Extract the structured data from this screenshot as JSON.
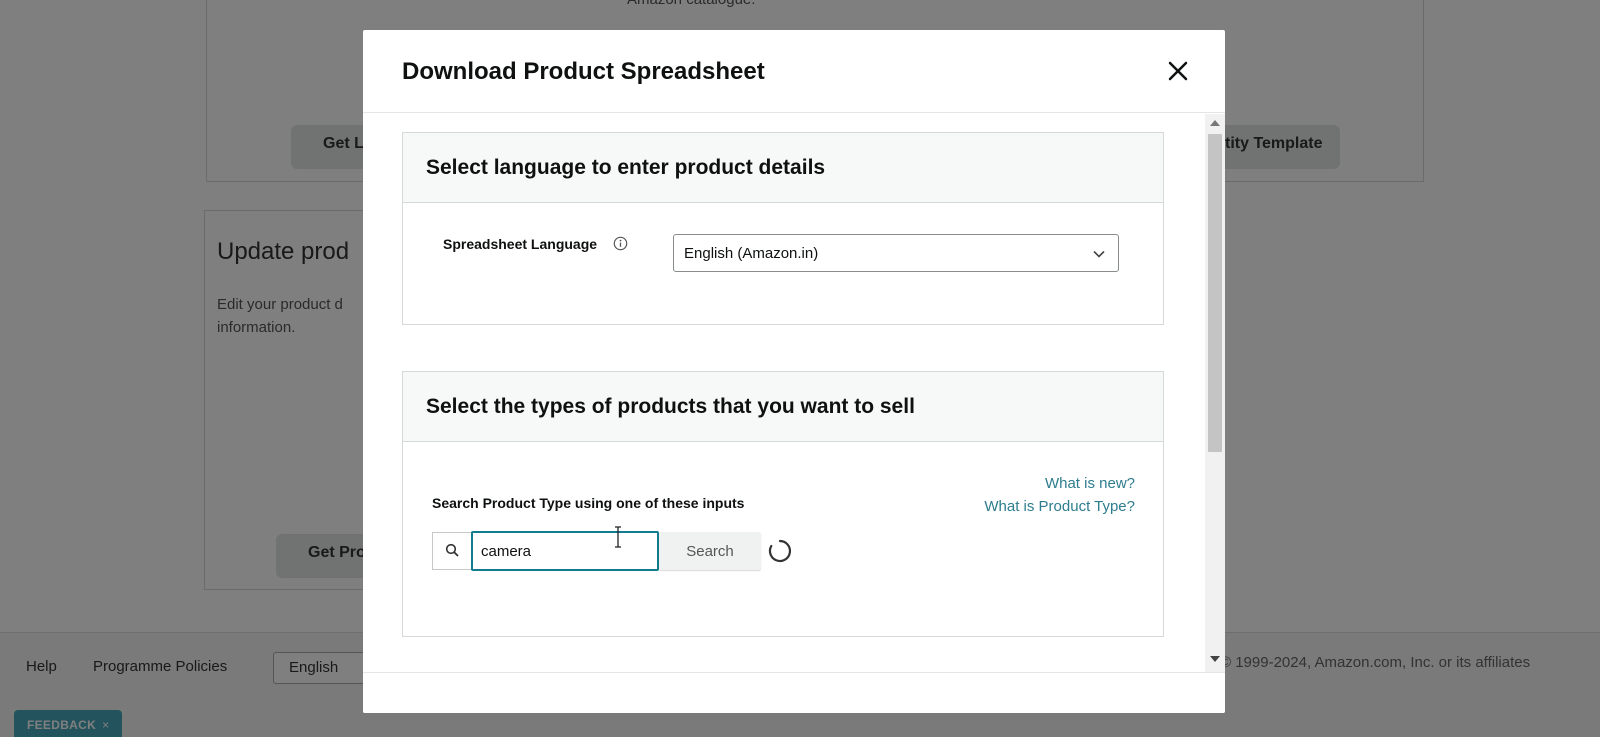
{
  "background": {
    "get_button_left": "Get L",
    "get_template_right": "tity Template",
    "update_title": "Update prod",
    "update_desc_line1": "Edit your product d",
    "update_desc_line2": "information.",
    "get_button_bottom": "Get Pro",
    "partial_top_text": "Amazon catalogue."
  },
  "footer": {
    "help": "Help",
    "policies": "Programme Policies",
    "language": "English",
    "copyright": "© 1999-2024, Amazon.com, Inc. or its affiliates",
    "feedback": "FEEDBACK",
    "feedback_close": "×"
  },
  "modal": {
    "title": "Download Product Spreadsheet",
    "close_icon": "close-icon",
    "language_section": {
      "title": "Select language to enter product details",
      "label": "Spreadsheet Language",
      "info_icon": "info-icon",
      "selected": "English (Amazon.in)",
      "chevron_icon": "chevron-down-icon"
    },
    "product_section": {
      "title": "Select the types of products that you want to sell",
      "link_new": "What is new?",
      "link_product_type": "What is Product Type?",
      "search_label": "Search Product Type using one of these inputs",
      "search_value": "camera",
      "search_button": "Search",
      "search_icon": "search-icon"
    }
  },
  "colors": {
    "accent": "#127c8e",
    "link": "#2d7d8e",
    "feedback": "#47a7b9"
  }
}
